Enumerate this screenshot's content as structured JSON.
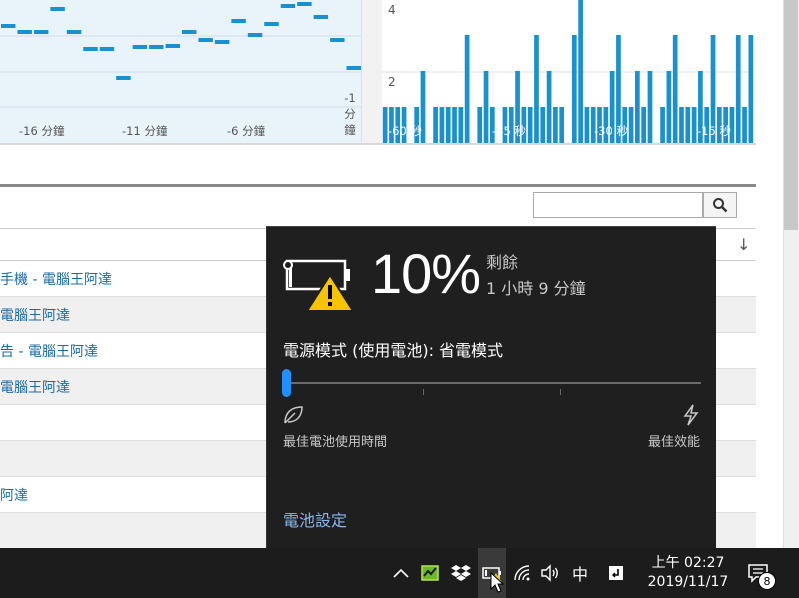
{
  "left_chart": {
    "x_labels": [
      "-16 分鐘",
      "-11 分鐘",
      "-6 分鐘",
      "-1",
      "分",
      "鐘"
    ],
    "steps": [
      24,
      30,
      30,
      7,
      30,
      47,
      47,
      76,
      45,
      45,
      44,
      30,
      38,
      40,
      19,
      33,
      22,
      4,
      2,
      15,
      38,
      66
    ]
  },
  "right_chart": {
    "y_labels": [
      "4",
      "2"
    ],
    "x_labels": [
      "-60 秒",
      "-45 秒",
      "-30 秒",
      "-15 秒"
    ],
    "bar_color": "#1a91cf",
    "bars": [
      1,
      1,
      1,
      1,
      0,
      1,
      2,
      0,
      1,
      1,
      1,
      1,
      1,
      3,
      0,
      1,
      2,
      1,
      0,
      1,
      1,
      2,
      1,
      1,
      3,
      1,
      2,
      1,
      1,
      0,
      3,
      4,
      1,
      1,
      1,
      1,
      2,
      3,
      1,
      1,
      2,
      1,
      2,
      0,
      1,
      2,
      3,
      1,
      1,
      1,
      2,
      1,
      3,
      1,
      1,
      1,
      3,
      1,
      3
    ]
  },
  "table": {
    "rows": [
      "手機 - 電腦王阿達",
      "電腦王阿達",
      "告 - 電腦王阿達",
      "電腦王阿達",
      "",
      "",
      "阿達",
      ""
    ]
  },
  "flyout": {
    "percent": "10%",
    "remaining_label": "剩餘",
    "remaining_time": "1 小時 9 分鐘",
    "power_mode": "電源模式 (使用電池): 省電模式",
    "slider_value": 0,
    "left_label": "最佳電池使用時間",
    "right_label": "最佳效能",
    "settings_link": "電池設定",
    "accent": "#1e90ff",
    "warning_color": "#f5c400"
  },
  "taskbar": {
    "tray_icons": [
      "chevron-up-icon",
      "green-app-icon",
      "dropbox-icon",
      "battery-icon",
      "wifi-icon",
      "volume-icon"
    ],
    "ime": "中",
    "time": "上午 02:27",
    "date": "2019/11/17",
    "notification_count": "8"
  }
}
